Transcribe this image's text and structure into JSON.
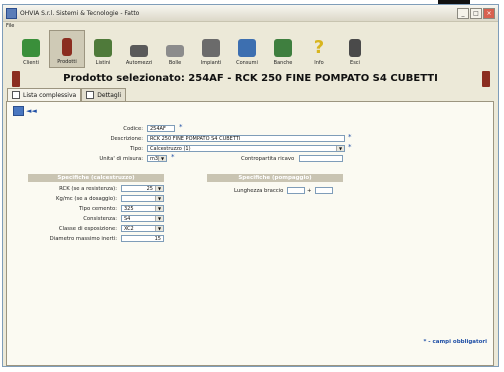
{
  "window": {
    "title": "OHVIA S.r.l. Sistemi & Tecnologie - Fatto",
    "menu": "File"
  },
  "toolbar": {
    "items": [
      {
        "label": "Clienti",
        "icon": "clients-icon",
        "color": "#3a8f3a"
      },
      {
        "label": "Prodotti",
        "icon": "products-icon",
        "color": "#8b2d20"
      },
      {
        "label": "Listini",
        "icon": "price-list-icon",
        "color": "#4f7a3a"
      },
      {
        "label": "Automezzi",
        "icon": "truck-icon",
        "color": "#5a5a5a"
      },
      {
        "label": "Bolle",
        "icon": "printer-icon",
        "color": "#8c8c8c"
      },
      {
        "label": "Impianti",
        "icon": "plant-icon",
        "color": "#6b6b6b"
      },
      {
        "label": "Consumi",
        "icon": "consumption-icon",
        "color": "#3d6fb0"
      },
      {
        "label": "Banche",
        "icon": "bank-icon",
        "color": "#3f7f3f"
      },
      {
        "label": "Info",
        "icon": "question-icon",
        "color": "#d8b51f"
      },
      {
        "label": "Esci",
        "icon": "exit-icon",
        "color": "#4a4a4a"
      }
    ]
  },
  "product": {
    "title": "Prodotto selezionato:   254AF - RCK 250 FINE POMPATO S4 CUBETTI"
  },
  "tabs": [
    {
      "label": "Lista complessiva"
    },
    {
      "label": "Dettagli"
    }
  ],
  "form": {
    "codice_label": "Codice:",
    "codice_value": "254AF",
    "descrizione_label": "Descrizione:",
    "descrizione_value": "RCK 250 FINE POMPATO S4 CUBETTI",
    "tipo_label": "Tipo:",
    "tipo_value": "Calcestruzzo  (1)",
    "um_label": "Unita' di misura:",
    "um_value": "m3",
    "contropartita_label": "Contropartita ricavo",
    "contropartita_value": "",
    "section_calcestruzzo": "Specifiche (calcestruzzo)",
    "section_pompaggio": "Specifiche (pompaggio)",
    "rck_label": "RCK (se a resistenza):",
    "rck_value": "25",
    "kgmc_label": "Kg/mc (se a dosaggio):",
    "kgmc_value": "",
    "tipo_cemento_label": "Tipo cemento:",
    "tipo_cemento_value": "325",
    "consistenza_label": "Consistenza:",
    "consistenza_value": "S4",
    "classe_label": "Classe di esposizione:",
    "classe_value": "XC2",
    "diametro_label": "Diametro massimo inerti:",
    "diametro_value": "15",
    "lunghezza_label": "Lunghezza braccio",
    "lunghezza_plus": "+",
    "required_note": "* - campi obbligatori"
  }
}
